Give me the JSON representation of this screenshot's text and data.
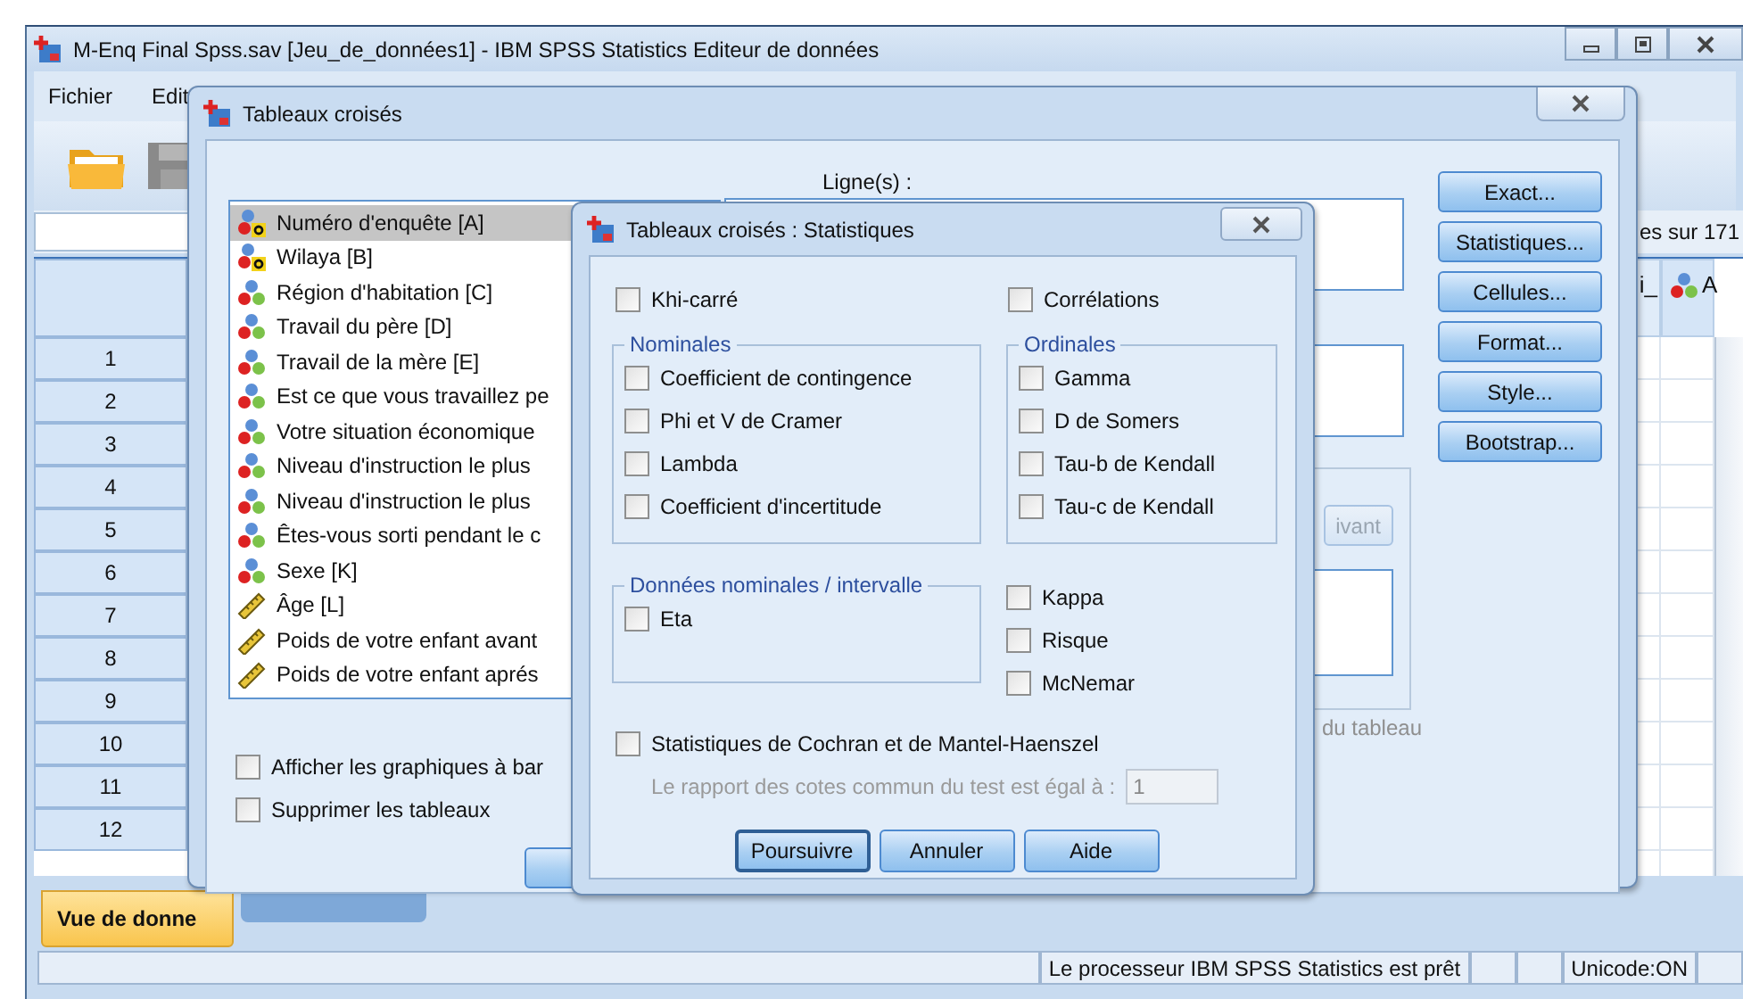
{
  "main_window": {
    "title": "M-Enq Final Spss.sav [Jeu_de_données1] - IBM SPSS Statistics Editeur de données",
    "menu": [
      {
        "label": "Fichier"
      },
      {
        "label": "Edit"
      }
    ],
    "case_count": "es sur 171",
    "column_headers": [
      {
        "text": "i_",
        "kind": "plain"
      },
      {
        "text": "A",
        "kind": "nominal"
      }
    ],
    "row_numbers": [
      "1",
      "2",
      "3",
      "4",
      "5",
      "6",
      "7",
      "8",
      "9",
      "10",
      "11",
      "12"
    ],
    "view_tabs": [
      {
        "label": "Vue de donne",
        "selected": true
      }
    ],
    "status_bar": {
      "message": "Le processeur IBM SPSS Statistics  est prêt",
      "encoding": "Unicode:ON"
    }
  },
  "crosstabs_dialog": {
    "title": "Tableaux croisés",
    "variables": [
      {
        "name": "Numéro d'enquête [A]",
        "kind": "string",
        "selected": true
      },
      {
        "name": "Wilaya  [B]",
        "kind": "string",
        "selected": false
      },
      {
        "name": "Région d'habitation  [C]",
        "kind": "nominal",
        "selected": false
      },
      {
        "name": "Travail du père  [D]",
        "kind": "nominal",
        "selected": false
      },
      {
        "name": "Travail de la mère  [E]",
        "kind": "nominal",
        "selected": false
      },
      {
        "name": "Est ce que vous travaillez pe",
        "kind": "nominal",
        "selected": false
      },
      {
        "name": "Votre situation économique",
        "kind": "nominal",
        "selected": false
      },
      {
        "name": "Niveau d'instruction le plus",
        "kind": "nominal",
        "selected": false
      },
      {
        "name": "Niveau d'instruction le plus",
        "kind": "nominal",
        "selected": false
      },
      {
        "name": "Êtes-vous sorti pendant le c",
        "kind": "nominal",
        "selected": false
      },
      {
        "name": "Sexe [K]",
        "kind": "nominal",
        "selected": false
      },
      {
        "name": "Âge  [L]",
        "kind": "scale",
        "selected": false
      },
      {
        "name": "Poids de votre enfant avant",
        "kind": "scale",
        "selected": false
      },
      {
        "name": "Poids de votre enfant aprés",
        "kind": "scale",
        "selected": false
      }
    ],
    "rows_label": "Ligne(s) :",
    "next_button": {
      "label": "ivant",
      "disabled": true
    },
    "layer_note": "du tableau",
    "options": [
      {
        "label": "Afficher les graphiques à bar",
        "checked": false
      },
      {
        "label": "Supprimer les tableaux",
        "checked": false
      }
    ],
    "side_buttons": [
      "Exact...",
      "Statistiques...",
      "Cellules...",
      "Format...",
      "Style...",
      "Bootstrap..."
    ]
  },
  "statistics_dialog": {
    "title": "Tableaux croisés : Statistiques",
    "chi_square": {
      "label": "Khi-carré",
      "checked": false
    },
    "correlations": {
      "label": "Corrélations",
      "checked": false
    },
    "nominal": {
      "title": "Nominales",
      "options": [
        {
          "label": "Coefficient de contingence",
          "checked": false
        },
        {
          "label": "Phi et V de Cramer",
          "checked": false
        },
        {
          "label": "Lambda",
          "checked": false
        },
        {
          "label": "Coefficient d'incertitude",
          "checked": false
        }
      ]
    },
    "ordinal": {
      "title": "Ordinales",
      "options": [
        {
          "label": "Gamma",
          "checked": false
        },
        {
          "label": "D de Somers",
          "checked": false
        },
        {
          "label": "Tau-b de Kendall",
          "checked": false
        },
        {
          "label": "Tau-c de Kendall",
          "checked": false
        }
      ]
    },
    "nominal_interval": {
      "title": "Données nominales / intervalle",
      "options": [
        {
          "label": "Eta",
          "checked": false
        }
      ]
    },
    "other_options": [
      {
        "label": "Kappa",
        "checked": false
      },
      {
        "label": "Risque",
        "checked": false
      },
      {
        "label": "McNemar",
        "checked": false
      }
    ],
    "cochran": {
      "label": "Statistiques de Cochran et de Mantel-Haenszel",
      "checked": false
    },
    "common_odds_ratio": {
      "label": "Le rapport des cotes commun du test est égal à :",
      "value": "1",
      "disabled": true
    },
    "buttons": [
      {
        "label": "Poursuivre",
        "default": true
      },
      {
        "label": "Annuler",
        "default": false
      },
      {
        "label": "Aide",
        "default": false
      }
    ]
  }
}
